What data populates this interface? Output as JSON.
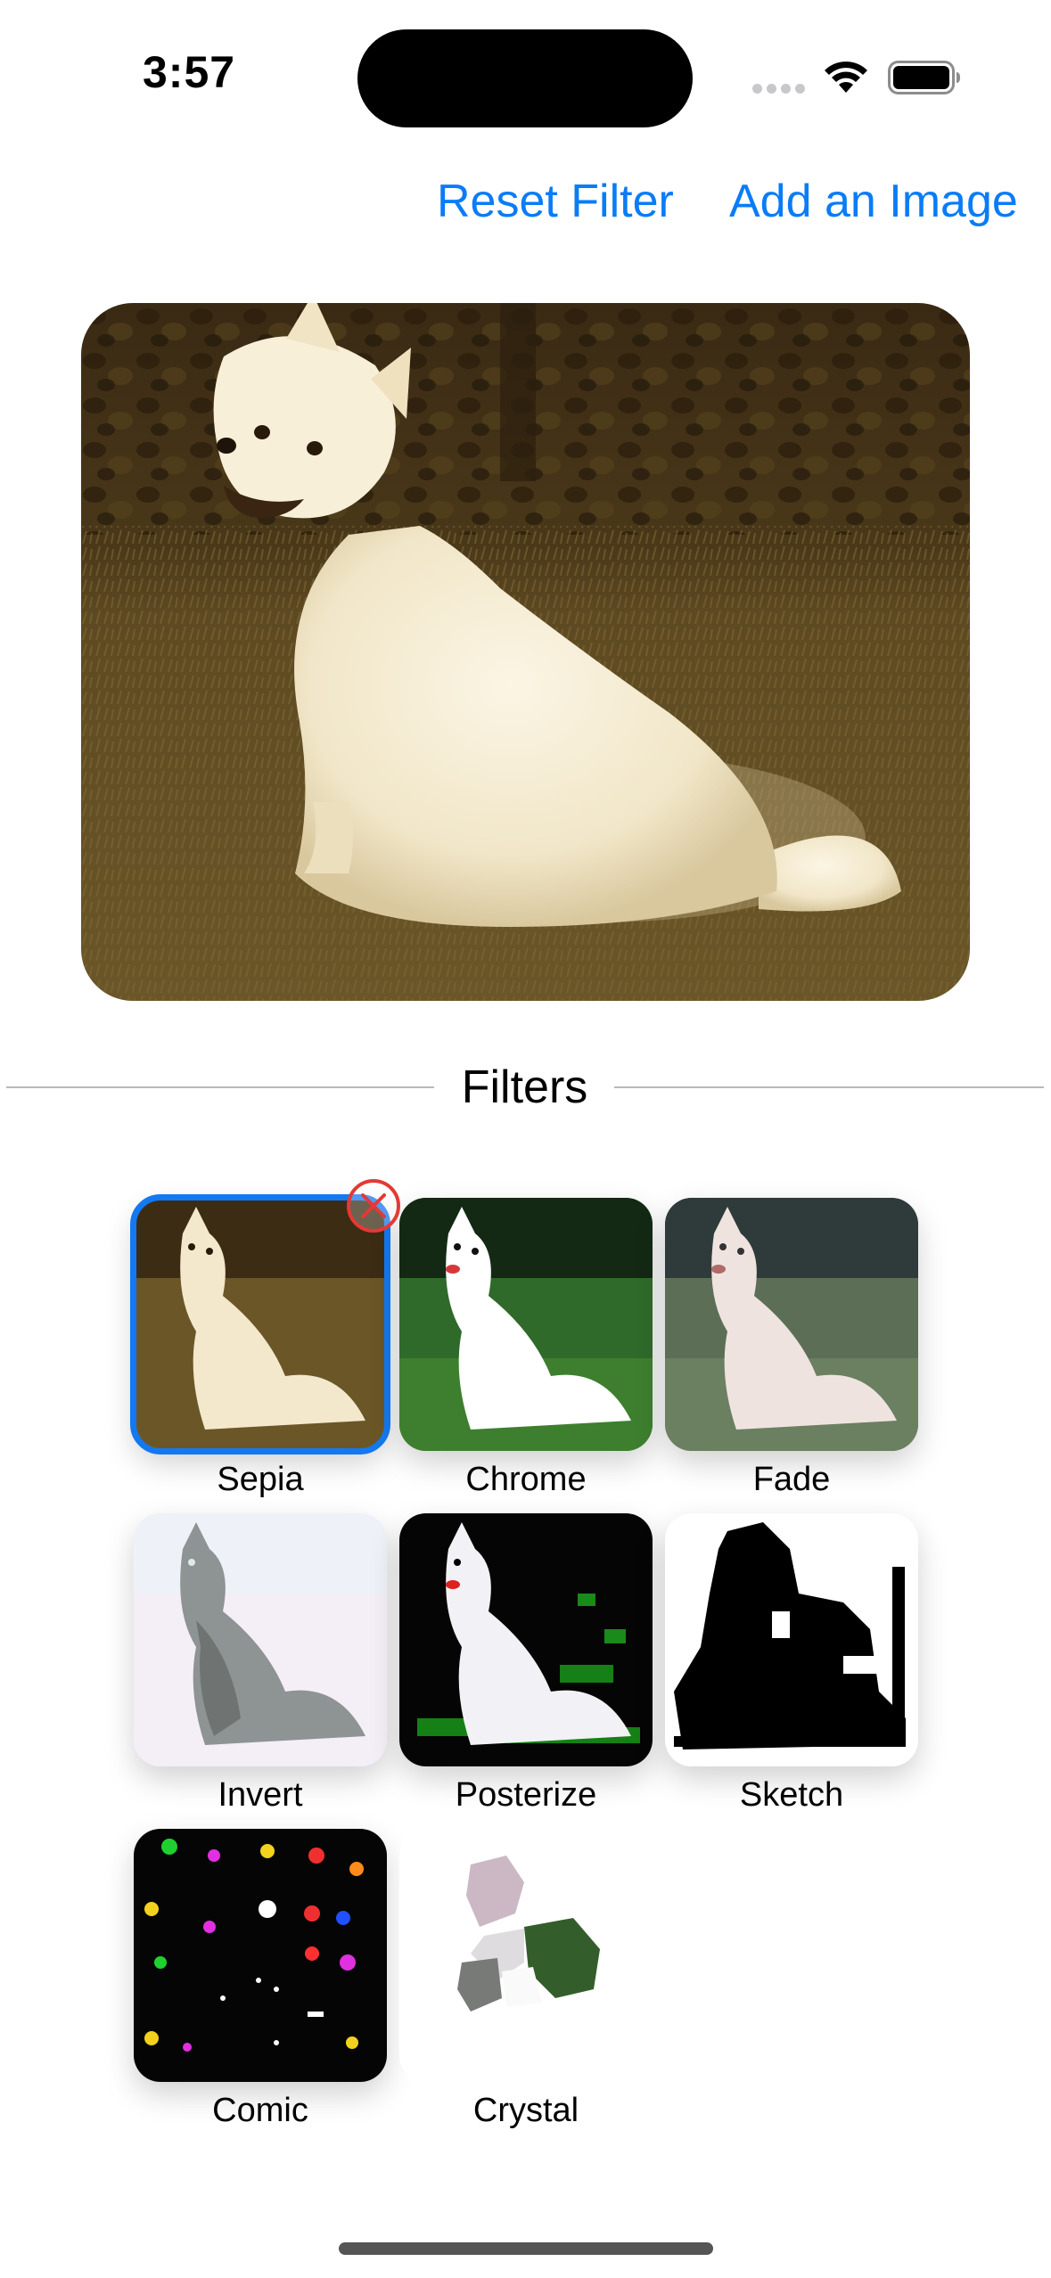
{
  "status_bar": {
    "time": "3:57"
  },
  "nav": {
    "reset_label": "Reset Filter",
    "add_label": "Add an Image"
  },
  "filters_section": {
    "title": "Filters"
  },
  "filters": [
    {
      "name": "Sepia",
      "selected": true
    },
    {
      "name": "Chrome",
      "selected": false
    },
    {
      "name": "Fade",
      "selected": false
    },
    {
      "name": "Invert",
      "selected": false
    },
    {
      "name": "Posterize",
      "selected": false
    },
    {
      "name": "Sketch",
      "selected": false
    },
    {
      "name": "Comic",
      "selected": false
    },
    {
      "name": "Crystal",
      "selected": false
    }
  ],
  "colors": {
    "accent": "#0a7cf6",
    "selection": "#1479f0",
    "remove_badge": "#e53935"
  }
}
